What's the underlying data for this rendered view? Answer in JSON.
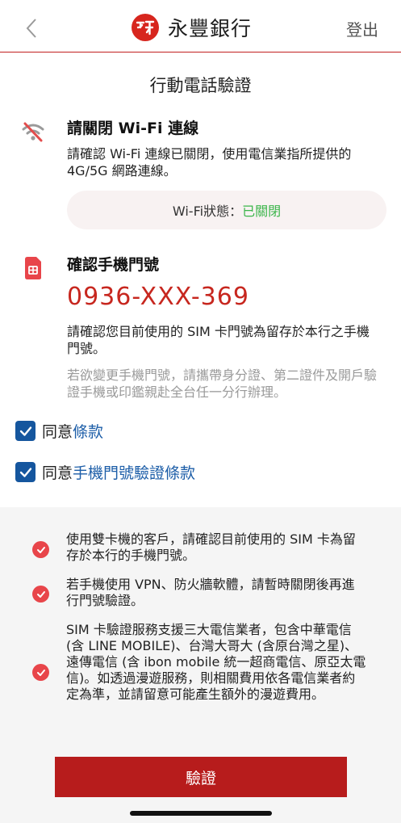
{
  "header": {
    "brand_name": "永豐銀行",
    "logout_label": "登出",
    "back_icon": "chevron-left-icon",
    "logo_icon": "sinopac-logo"
  },
  "page_title": "行動電話驗證",
  "wifi_section": {
    "icon": "wifi-off-icon",
    "title": "請關閉 Wi-Fi 連線",
    "description": "請確認 Wi-Fi 連線已關閉，使用電信業指所提供的 4G/5G 網路連線。",
    "status_label": "Wi-Fi狀態：",
    "status_value": "已關閉"
  },
  "phone_section": {
    "icon": "sim-card-icon",
    "title": "確認手機門號",
    "phone_number": "0936-XXX-369",
    "description": "請確認您目前使用的 SIM 卡門號為留存於本行之手機門號。",
    "note": "若欲變更手機門號，請攜帶身分證、第二證件及開戶驗證手機或印鑑親赴全台任一分行辦理。"
  },
  "agreements": [
    {
      "prefix": "同意",
      "link": "條款",
      "checked": true
    },
    {
      "prefix": "同意",
      "link": "手機門號驗證條款",
      "checked": true
    }
  ],
  "notices": [
    "使用雙卡機的客戶，請確認目前使用的 SIM 卡為留存於本行的手機門號。",
    "若手機使用 VPN、防火牆軟體，請暫時關閉後再進行門號驗證。",
    "SIM 卡驗證服務支援三大電信業者，包含中華電信 (含 LINE MOBILE)、台灣大哥大 (含原台灣之星)、遠傳電信 (含 ibon mobile 統一超商電信、原亞太電信)。如透過漫遊服務，則相關費用依各電信業者約定為準，並請留意可能產生額外的漫遊費用。"
  ],
  "verify_button_label": "驗證",
  "colors": {
    "brand_red": "#c7271f",
    "button_red": "#b71c1c",
    "checkbox_blue": "#15569e",
    "status_green": "#3bb54a",
    "notice_red": "#e8454a"
  }
}
